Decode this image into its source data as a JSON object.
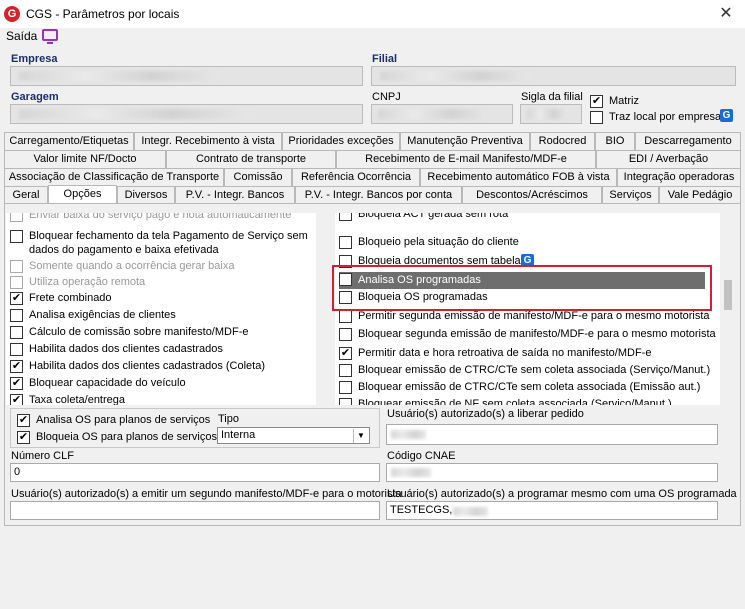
{
  "window": {
    "title": "CGS - Parâmetros por locais",
    "close": "✕"
  },
  "menu": {
    "saida": "Saída"
  },
  "header": {
    "empresa_label": "Empresa",
    "filial_label": "Filial",
    "garagem_label": "Garagem",
    "cnpj_label": "CNPJ",
    "sigla_label": "Sigla da filial",
    "matriz": {
      "label": "Matriz",
      "checked": true
    },
    "traz_local": {
      "label": "Traz local por empresa",
      "checked": false
    }
  },
  "tabs": {
    "row1": [
      "Carregamento/Etiquetas",
      "Integr. Recebimento à vista",
      "Prioridades exceções",
      "Manutenção Preventiva",
      "Rodocred",
      "BIO",
      "Descarregamento"
    ],
    "row2": [
      "Valor limite NF/Docto",
      "Contrato de transporte",
      "Recebimento de E-mail Manifesto/MDF-e",
      "EDI / Averbação"
    ],
    "row3": [
      "Associação de Classificação de Transporte",
      "Comissão",
      "Referência Ocorrência",
      "Recebimento automático FOB à vista",
      "Integração operadoras"
    ],
    "row4": [
      "Geral",
      "Opções",
      "Diversos",
      "P.V. - Integr. Bancos",
      "P.V. - Integr. Bancos por conta",
      "Descontos/Acréscimos",
      "Serviços",
      "Vale Pedágio"
    ],
    "active": "Opções"
  },
  "left_options": [
    {
      "label": "Enviar baixa do serviço pago e nota automaticamente",
      "checked": false,
      "disabled": true
    },
    {
      "label": "Bloquear fechamento da tela Pagamento de Serviço sem",
      "label2": "dados do pagamento e baixa efetivada",
      "checked": false,
      "disabled": false
    },
    {
      "label": "Somente quando a ocorrência gerar baixa",
      "checked": false,
      "disabled": true
    },
    {
      "label": "Utiliza operação remota",
      "checked": false,
      "disabled": true
    },
    {
      "label": "Frete combinado",
      "checked": true,
      "disabled": false
    },
    {
      "label": "Analisa exigências de clientes",
      "checked": false,
      "disabled": false
    },
    {
      "label": "Cálculo de comissão sobre manifesto/MDF-e",
      "checked": false,
      "disabled": false
    },
    {
      "label": "Habilita dados dos clientes cadastrados",
      "checked": false,
      "disabled": false
    },
    {
      "label": "Habilita dados dos clientes cadastrados (Coleta)",
      "checked": true,
      "disabled": false
    },
    {
      "label": "Bloquear capacidade do veículo",
      "checked": true,
      "disabled": false
    },
    {
      "label": "Taxa coleta/entrega",
      "checked": true,
      "disabled": false
    }
  ],
  "right_options": [
    {
      "label": "Bloqueia ACT gerada sem rota",
      "checked": false
    },
    {
      "label": "Bloqueio pela situação do cliente",
      "checked": false
    },
    {
      "label": "Bloqueia documentos sem tabela",
      "checked": false
    },
    {
      "label": "Analisa OS programadas",
      "checked": true
    },
    {
      "label": "Bloqueia OS programadas",
      "checked": false
    },
    {
      "label": "Permitir segunda emissão de manifesto/MDF-e para o mesmo motorista",
      "checked": false
    },
    {
      "label": "Bloquear segunda emissão de manifesto/MDF-e para o mesmo motorista",
      "checked": false
    },
    {
      "label": "Permitir data e hora retroativa de saída no manifesto/MDF-e",
      "checked": true
    },
    {
      "label": "Bloquear emissão de CTRC/CTe sem coleta associada (Serviço/Manut.)",
      "checked": false
    },
    {
      "label": "Bloquear emissão de CTRC/CTe sem coleta associada (Emissão aut.)",
      "checked": false
    },
    {
      "label": "Bloquear emissão de NF sem coleta associada (Serviço/Manut.)",
      "checked": false
    }
  ],
  "os_group": {
    "analisa": {
      "label": "Analisa OS para planos de serviços",
      "checked": true
    },
    "bloqueia": {
      "label": "Bloqueia OS para planos de serviços",
      "checked": true
    },
    "tipo_label": "Tipo",
    "tipo_value": "Interna"
  },
  "fields": {
    "liberar_pedido_label": "Usuário(s) autorizado(s) a liberar pedido",
    "numero_clf_label": "Número CLF",
    "numero_clf_value": "0",
    "codigo_cnae_label": "Código CNAE",
    "segundo_manifesto_label": "Usuário(s) autorizado(s) a emitir um segundo manifesto/MDF-e para o motorista",
    "programar_os_label": "Usuário(s) autorizado(s) a programar mesmo com uma OS programada",
    "programar_os_value": "TESTECGS,"
  },
  "colors": {
    "accent": "#1a6ad8",
    "highlight": "#d0212e",
    "selected": "#6e6e6e",
    "header_label": "#1a2e6e"
  }
}
